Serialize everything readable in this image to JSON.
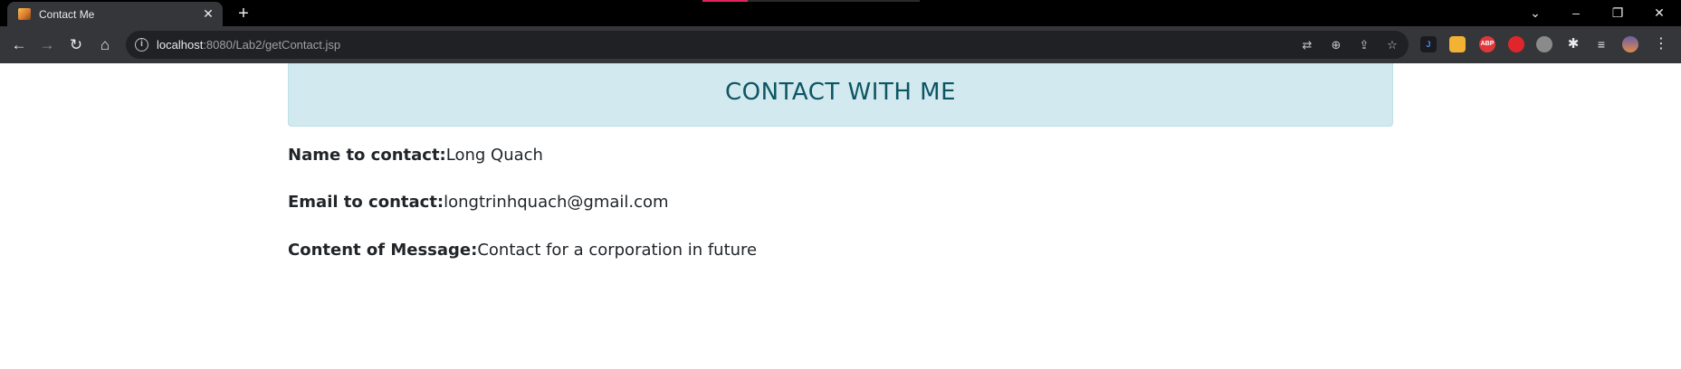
{
  "browser": {
    "tab": {
      "title": "Contact Me"
    },
    "url": {
      "host": "localhost",
      "path": ":8080/Lab2/getContact.jsp"
    },
    "toolbar_icons": [
      "back-icon",
      "forward-icon",
      "reload-icon",
      "home-icon"
    ],
    "omnibox_icons": [
      "translate-icon",
      "zoom-icon",
      "share-icon",
      "bookmark-star-icon"
    ],
    "extensions": [
      {
        "name": "j-extension-icon",
        "glyph": "J",
        "color": "#1a73e8"
      },
      {
        "name": "colorful-extension-icon",
        "glyph": "",
        "color": "#f2b233"
      },
      {
        "name": "adblock-icon",
        "glyph": "ABP",
        "color": "#e0383a"
      },
      {
        "name": "stop-hand-extension-icon",
        "glyph": "",
        "color": "#e0262a"
      },
      {
        "name": "mask-extension-icon",
        "glyph": "",
        "color": "#8a8a8a"
      }
    ]
  },
  "page": {
    "header": "CONTACT WITH ME",
    "fields": [
      {
        "label": "Name to contact:",
        "value": "Long Quach"
      },
      {
        "label": "Email to contact:",
        "value": "longtrinhquach@gmail.com"
      },
      {
        "label": "Content of Message:",
        "value": "Contact for a corporation in future"
      }
    ]
  }
}
